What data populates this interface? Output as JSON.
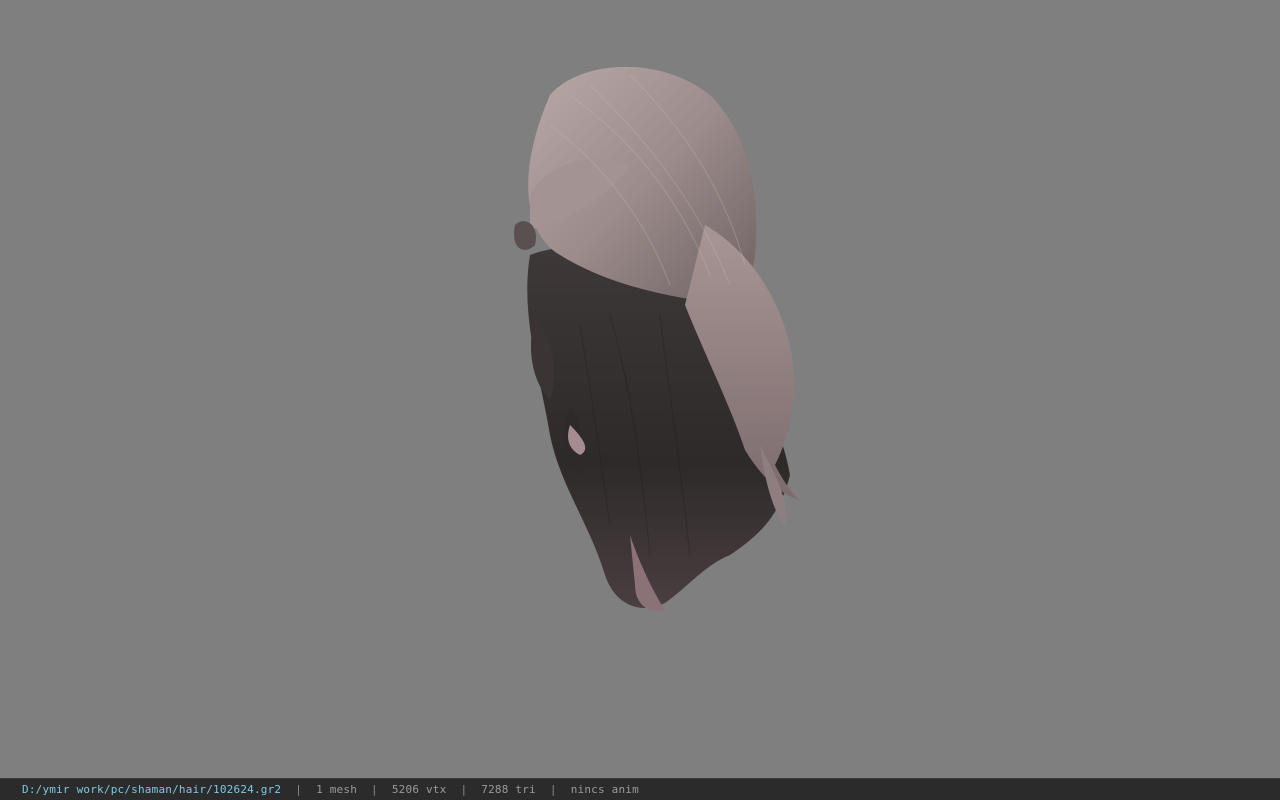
{
  "viewer": {
    "background_color": "#7f7f7f",
    "model_icon": "hair-mesh-3d-model"
  },
  "statusbar": {
    "file_path": "D:/ymir work/pc/shaman/hair/102624.gr2",
    "separator": "|",
    "mesh_count": "1 mesh",
    "vertex_count": "5206 vtx",
    "triangle_count": "7288 tri",
    "anim_status": "nincs anim",
    "path_color": "#7ec8e3"
  }
}
